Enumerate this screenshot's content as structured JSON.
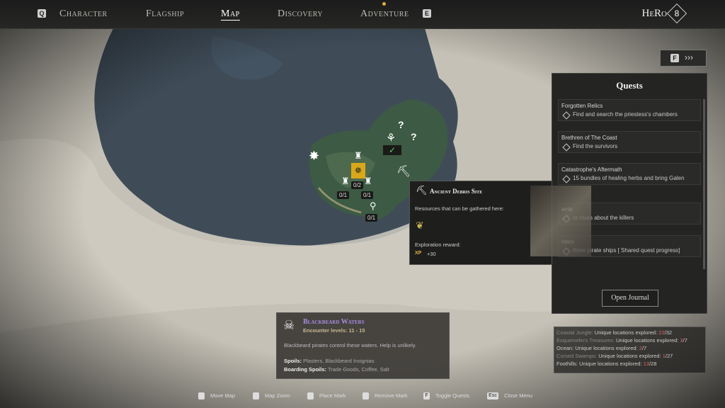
{
  "tabs": {
    "left_key": "Q",
    "right_key": "E",
    "items": [
      "Character",
      "Flagship",
      "Map",
      "Discovery",
      "Adventure"
    ],
    "active": "Map"
  },
  "player": {
    "name": "HeRo",
    "level": "8"
  },
  "side_button": {
    "key": "F",
    "label": "›››"
  },
  "quests": {
    "title": "Quests",
    "items": [
      {
        "name": "Forgotten Relics",
        "task": "Find and search the priestess's chambers"
      },
      {
        "name": "Brethren of The Coast",
        "task": "Find the survivors"
      },
      {
        "name": "Catastrophe's Aftermath",
        "task": "15 bundles of healing herbs and bring Galen"
      },
      {
        "name": "amb",
        "task": "or clues about the killers"
      },
      {
        "name": "nters",
        "task": "three pirate ships [ Shared quest progress]"
      }
    ],
    "journal_button": "Open Journal"
  },
  "tooltip": {
    "title": "Ancient Debris Site",
    "resources_label": "Resources that can be gathered here:",
    "reward_label": "Exploration reward:",
    "xp_icon": "XP",
    "xp_value": "+30"
  },
  "map_badges": {
    "fort_center": "0/2",
    "fort_left": "0/1",
    "fort_right": "0/1",
    "search": "0/1"
  },
  "region": {
    "name": "Blackbeard Waters",
    "encounter": "Encounter levels: 11 - 15",
    "description": "Blackbeard pirates control these waters. Help is unlikely.",
    "spoils_label": "Spoils:",
    "spoils_value": "Plasters, Blackbeard Insignias",
    "boarding_label": "Boarding Spoils:",
    "boarding_value": "Trade Goods, Coffee, Salt"
  },
  "exploration": [
    {
      "region": "Coastal Jungle:",
      "label": "Unique locations explored:",
      "found": "22",
      "total": "/32"
    },
    {
      "region": "Exquemelin's Treasures:",
      "label": "Unique locations explored:",
      "found": "3",
      "total": "/7"
    },
    {
      "region": "Ocean:",
      "label": "Unique locations explored:",
      "found": "2",
      "total": "/7"
    },
    {
      "region": "Cursed Swamps:",
      "label": "Unique locations explored:",
      "found": "1",
      "total": "/27"
    },
    {
      "region": "Foothills:",
      "label": "Unique locations explored:",
      "found": "13",
      "total": "/28"
    }
  ],
  "hints": [
    {
      "key": "",
      "label": "Move Map"
    },
    {
      "key": "",
      "label": "Map Zoom"
    },
    {
      "key": "",
      "label": "Place Mark"
    },
    {
      "key": "",
      "label": "Remove Mark"
    },
    {
      "key": "F",
      "label": "Toggle Quests"
    },
    {
      "key": "Esc",
      "label": "Close Menu"
    }
  ],
  "colors": {
    "sea": "#3f4c58",
    "land": "#3c5a44",
    "parchment": "#c8c4ba",
    "region_name": "#a98be0",
    "highlight": "#e06666",
    "active_icon": "#d9a81a"
  }
}
